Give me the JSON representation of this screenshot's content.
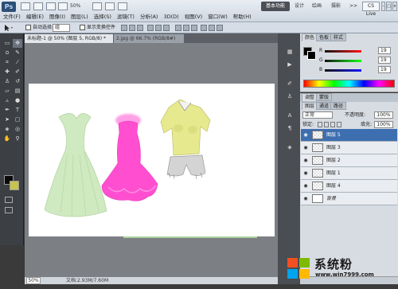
{
  "app": {
    "logo": "Ps",
    "zoom_menu": "50%"
  },
  "menu": [
    "文件(F)",
    "编辑(E)",
    "图像(I)",
    "图层(L)",
    "选择(S)",
    "滤镜(T)",
    "分析(A)",
    "3D(D)",
    "视图(V)",
    "窗口(W)",
    "帮助(H)"
  ],
  "workspaces": {
    "active": "基本功能",
    "items": [
      "设计",
      "绘画",
      "摄影"
    ],
    "more": ">>",
    "cs_live": "CS Live"
  },
  "options": {
    "auto_select_label": "自动选择:",
    "auto_select_value": "组",
    "show_transform_label": "显示变换控件"
  },
  "tabs": [
    {
      "label": "未标题-1 @ 50% (图层 5, RGB/8) *"
    },
    {
      "label": "2.jpg @ 66.7% (RGB/8#)"
    }
  ],
  "status": {
    "zoom": "50%",
    "doc": "文档:2.93M/7.60M"
  },
  "color_panel": {
    "tabs": [
      "颜色",
      "色板",
      "样式"
    ],
    "channels": [
      {
        "label": "R",
        "value": "19"
      },
      {
        "label": "G",
        "value": "19"
      },
      {
        "label": "B",
        "value": "19"
      }
    ]
  },
  "adj_tabs": [
    "调整",
    "蒙版"
  ],
  "layers_panel": {
    "tabs": [
      "图层",
      "通道",
      "路径"
    ],
    "blend_mode": "正常",
    "opacity_label": "不透明度:",
    "opacity_value": "100%",
    "lock_label": "锁定:",
    "fill_label": "填充:",
    "fill_value": "100%",
    "layers": [
      {
        "name": "图层 5",
        "selected": true
      },
      {
        "name": "图层 3",
        "selected": false
      },
      {
        "name": "图层 2",
        "selected": false
      },
      {
        "name": "图层 1",
        "selected": false
      },
      {
        "name": "图层 4",
        "selected": false
      },
      {
        "name": "背景",
        "selected": false
      }
    ]
  },
  "watermark": {
    "text": "系统粉",
    "url": "www.win7999.com"
  },
  "colors": {
    "fg": "#0a0a0a",
    "bg": "#c7c44c",
    "accent": "#3d6fb0"
  }
}
